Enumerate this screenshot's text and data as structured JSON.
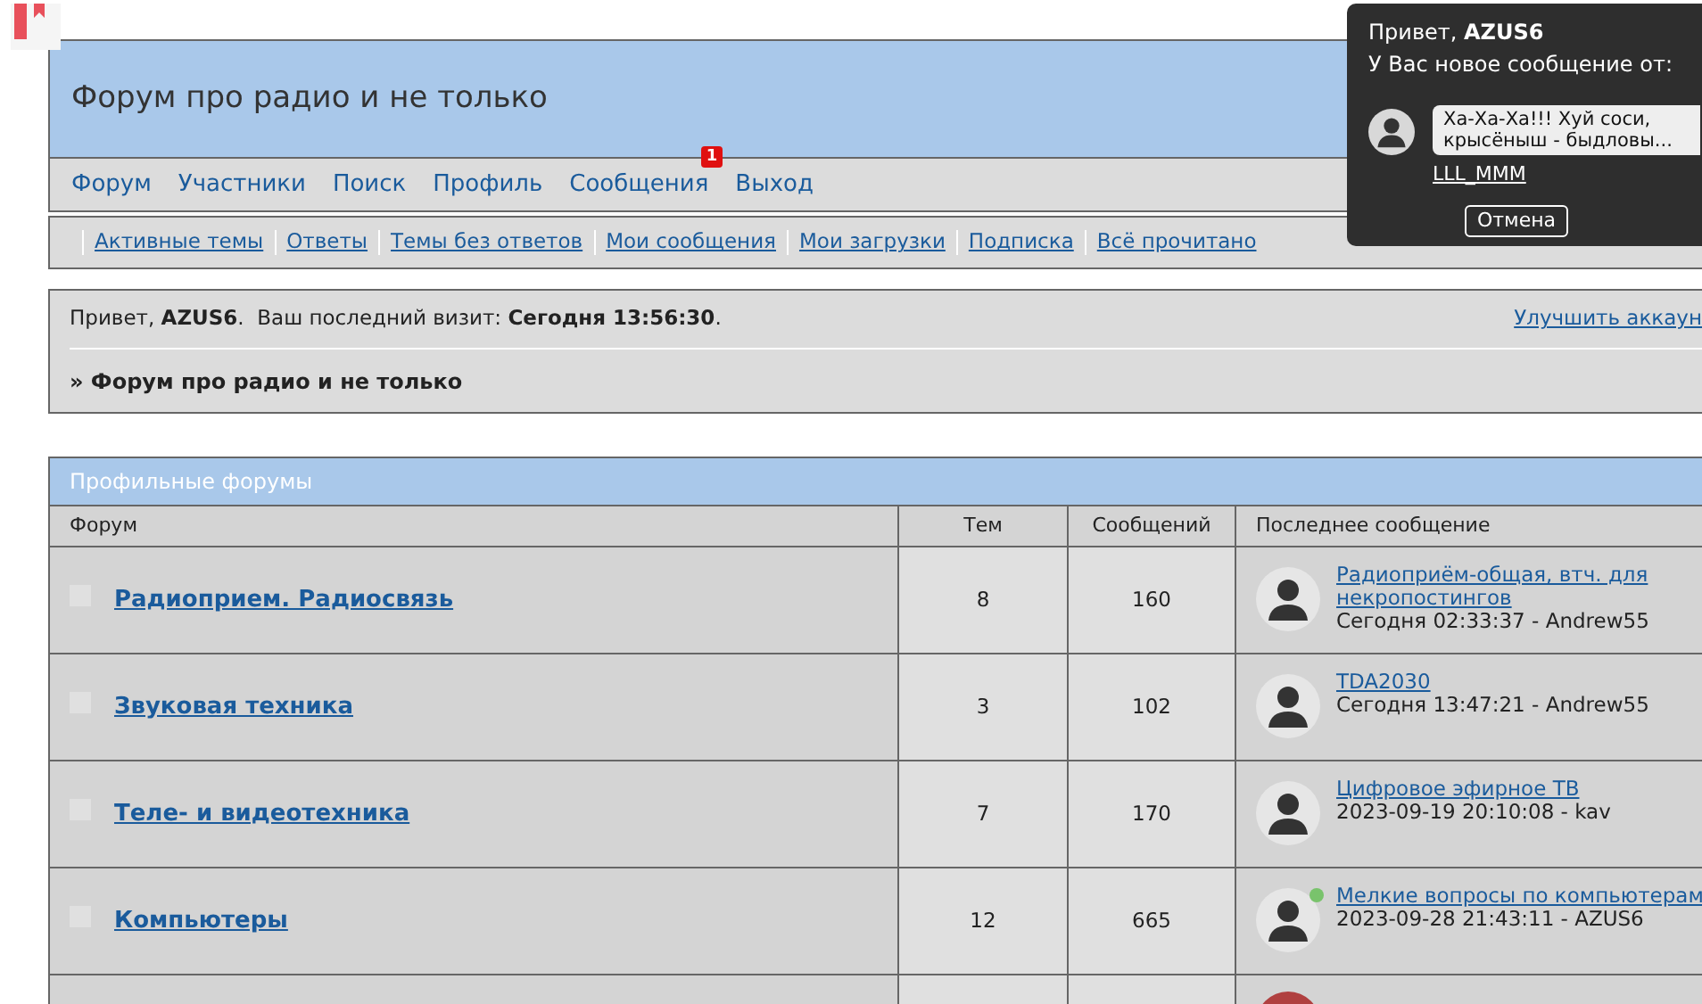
{
  "header": {
    "title": "Форум про радио и не только"
  },
  "nav": [
    {
      "label": "Форум"
    },
    {
      "label": "Участники"
    },
    {
      "label": "Поиск"
    },
    {
      "label": "Профиль"
    },
    {
      "label": "Сообщения",
      "badge": "1"
    },
    {
      "label": "Выход"
    }
  ],
  "subnav": [
    "Активные темы",
    "Ответы",
    "Темы без ответов",
    "Мои сообщения",
    "Мои загрузки",
    "Подписка",
    "Всё прочитано"
  ],
  "welcome": {
    "text": "Привет, **AZUS6**.  Ваш последний визит: **Сегодня 13:56:30**.",
    "upgrade_link": "Улучшить аккаун",
    "breadcrumb": "» Форум про радио и не только"
  },
  "category": {
    "title": "Профильные форумы",
    "columns": [
      "Форум",
      "Тем",
      "Сообщений",
      "Последнее сообщение"
    ],
    "rows": [
      {
        "name": "Радиоприем. Радиосвязь",
        "topics": "8",
        "posts": "160",
        "last_title": "Радиоприём-общая, втч. для некропостингов",
        "last_meta": "Сегодня 02:33:37 - Andrew55",
        "online": false
      },
      {
        "name": "Звуковая техника",
        "topics": "3",
        "posts": "102",
        "last_title": "TDA2030",
        "last_meta": "Сегодня 13:47:21 - Andrew55",
        "online": false
      },
      {
        "name": "Теле- и видеотехника",
        "topics": "7",
        "posts": "170",
        "last_title": "Цифровое эфирное ТВ",
        "last_meta": "2023-09-19 20:10:08 - kav",
        "online": false
      },
      {
        "name": "Компьютеры",
        "topics": "12",
        "posts": "665",
        "last_title": "Мелкие вопросы по компьютерам",
        "last_meta": "2023-09-28 21:43:11 - AZUS6",
        "online": true
      }
    ]
  },
  "popup": {
    "greeting": "Привет, **AZUS6**",
    "subtitle": "У Вас новое сообщение от:",
    "message": "Ха-Ха-Ха!!! Хуй соси, крысёныш - быдловы...",
    "sender": "LLL_MMM",
    "cancel": "Отмена"
  }
}
